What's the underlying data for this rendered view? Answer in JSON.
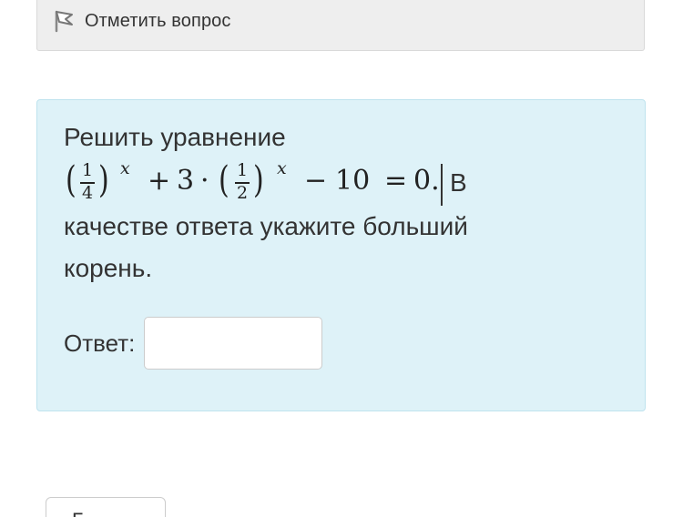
{
  "flag": {
    "label": "Отметить вопрос",
    "icon": "flag-icon"
  },
  "question": {
    "line1": "Решить уравнение",
    "equation": {
      "frac1_num": "1",
      "frac1_den": "4",
      "exp1": "x",
      "plus": "+",
      "three": "3",
      "dot": "·",
      "frac2_num": "1",
      "frac2_den": "2",
      "exp2": "x",
      "minus": "−",
      "ten": "10",
      "equals": "=",
      "zero": "0."
    },
    "after_equation": "В",
    "line3": "качестве ответа укажите больший",
    "line4": "корень.",
    "answer_label": "Ответ:",
    "answer_value": ""
  },
  "bottom_button": {
    "label": "Г"
  },
  "colors": {
    "question_bg": "#def2f8",
    "question_border": "#bfe3ee",
    "flag_bar_bg": "#eeeeee"
  }
}
